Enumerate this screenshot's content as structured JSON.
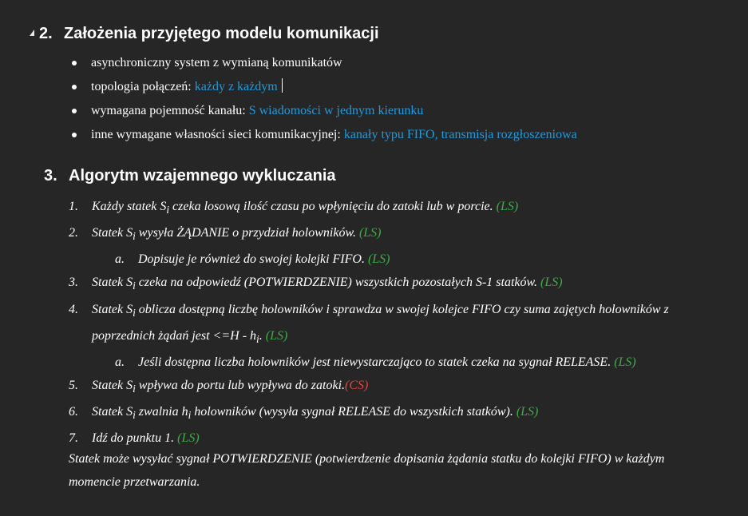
{
  "section2": {
    "number": "2.",
    "title": "Założenia przyjętego modelu komunikacji",
    "bullets": [
      {
        "label": "asynchroniczny system z wymianą komunikatów",
        "value": ""
      },
      {
        "label": "topologia połączeń: ",
        "value": "każdy z każdym"
      },
      {
        "label": "wymagana pojemność kanału: ",
        "value": "S wiadomości w jednym kierunku"
      },
      {
        "label": "inne wymagane własności sieci komunikacyjnej: ",
        "value": "kanały typu FIFO, transmisja rozgłoszeniowa"
      }
    ]
  },
  "section3": {
    "number": "3.",
    "title": "Algorytm wzajemnego wykluczania",
    "steps": [
      {
        "n": "1.",
        "text_before": "Każdy statek S",
        "sub": "i",
        "text_after": " czeka losową ilość czasu po wpłynięciu do zatoki lub w porcie. ",
        "tag": "(LS)",
        "tag_color": "green"
      },
      {
        "n": "2.",
        "text_before": "Statek S",
        "sub": "i",
        "text_after": " wysyła ŻĄDANIE o przydział holowników. ",
        "tag": "(LS)",
        "tag_color": "green"
      },
      {
        "n": "a.",
        "text_before": "Dopisuje je również do swojej kolejki FIFO. ",
        "sub": "",
        "text_after": "",
        "tag": "(LS)",
        "tag_color": "green",
        "subitem": true
      },
      {
        "n": "3.",
        "text_before": "Statek S",
        "sub": "i",
        "text_after": " czeka na odpowiedź (POTWIERDZENIE) wszystkich pozostałych S-1 statków. ",
        "tag": "(LS)",
        "tag_color": "green"
      },
      {
        "n": "4.",
        "text_before": "Statek S",
        "sub": "i",
        "text_after": "  oblicza dostępną liczbę holowników i sprawdza w swojej kolejce FIFO czy suma zajętych holowników z poprzednich żądań jest <=H - h",
        "sub2": "i",
        "text_end": ". ",
        "tag": "(LS)",
        "tag_color": "green"
      },
      {
        "n": "a.",
        "text_before": "Jeśli dostępna liczba holowników jest niewystarczająco to statek czeka na sygnał RELEASE. ",
        "sub": "",
        "text_after": "",
        "tag": "(LS)",
        "tag_color": "green",
        "subitem": true
      },
      {
        "n": "5.",
        "text_before": "Statek S",
        "sub": "i",
        "text_after": " wpływa do portu lub wypływa do zatoki.",
        "tag": "(CS)",
        "tag_color": "red"
      },
      {
        "n": "6.",
        "text_before": "Statek S",
        "sub": "i",
        "text_after": " zwalnia h",
        "sub2": "i",
        "text_end": " holowników (wysyła sygnał RELEASE do wszystkich statków). ",
        "tag": "(LS)",
        "tag_color": "green"
      },
      {
        "n": "7.",
        "text_before": "Idź do punktu 1. ",
        "sub": "",
        "text_after": "",
        "tag": "(LS)",
        "tag_color": "green"
      }
    ],
    "note": "Statek może wysyłać sygnał POTWIERDZENIE (potwierdzenie dopisania żądania statku do kolejki FIFO) w każdym momencie przetwarzania."
  },
  "colors": {
    "background": "#262626",
    "link_blue": "#1f9bde",
    "ls_green": "#3fab47",
    "cs_red": "#e8433d"
  }
}
